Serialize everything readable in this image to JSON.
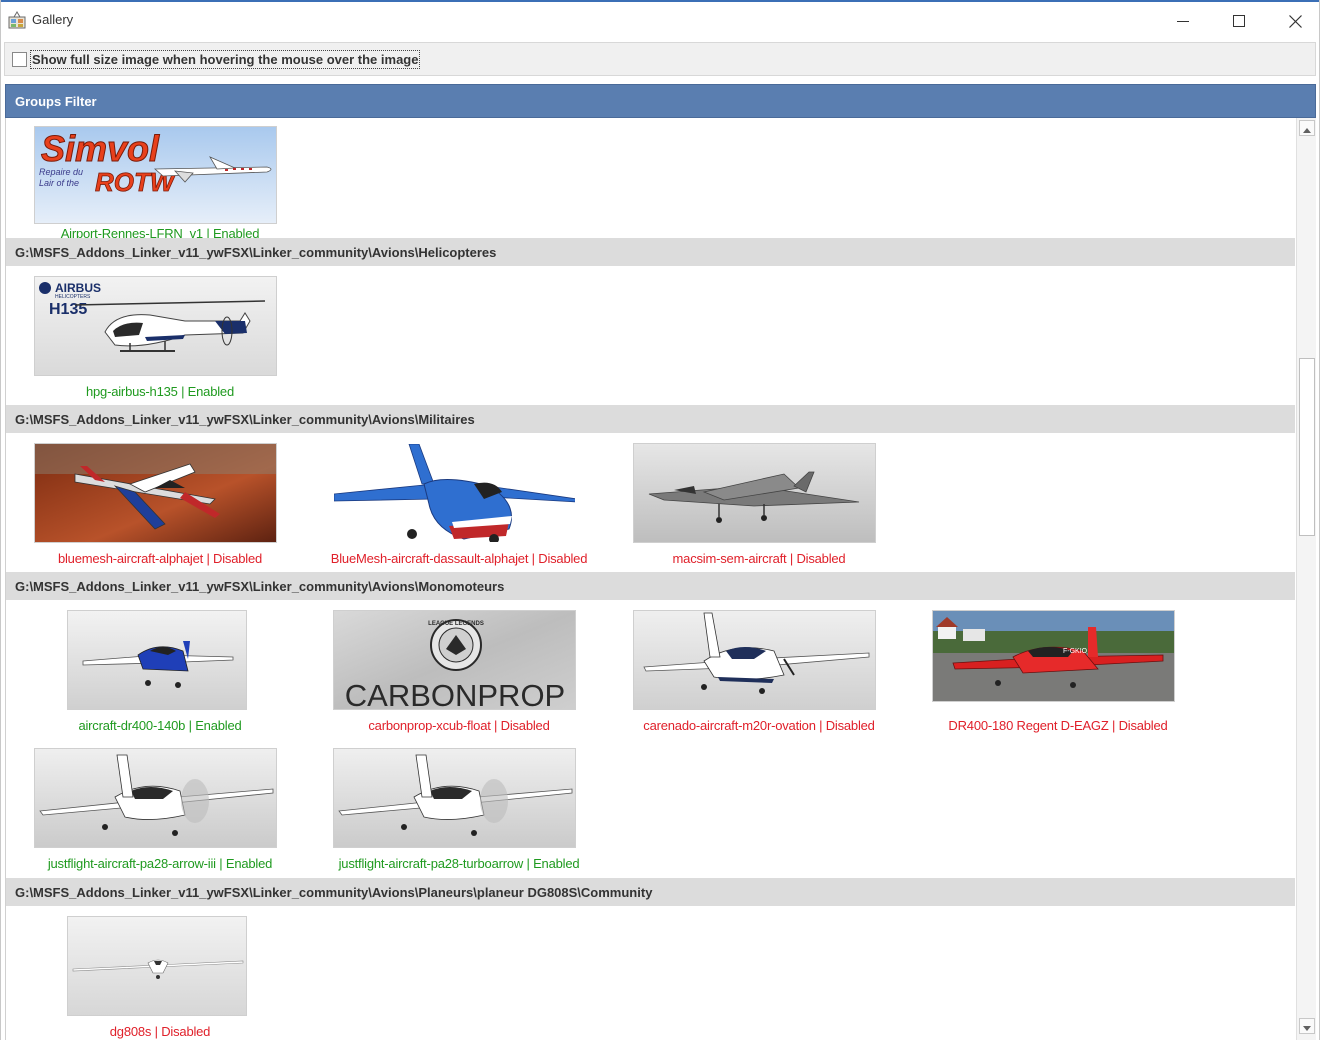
{
  "window": {
    "title": "Gallery",
    "minimize_icon": "minimize-icon",
    "maximize_icon": "maximize-icon",
    "close_icon": "close-icon"
  },
  "options": {
    "hover_checkbox_label": "Show full size image when hovering the mouse over the image",
    "hover_checked": false
  },
  "groups_filter": {
    "title": "Groups Filter"
  },
  "colors": {
    "enabled": "#1f9a1f",
    "disabled": "#e0202a",
    "header_blue": "#5a7eb0",
    "group_gray": "#dcdcdc"
  },
  "groups": [
    {
      "path": "",
      "items": [
        {
          "caption": "Airport-Rennes-LFRN_v1 | Enabled",
          "status": "enabled",
          "thumb": "simvol-rotw-logo"
        }
      ]
    },
    {
      "path": "G:\\MSFS_Addons_Linker_v11_ywFSX\\Linker_community\\Avions\\Helicopteres",
      "items": [
        {
          "caption": "hpg-airbus-h135 | Enabled",
          "status": "enabled",
          "thumb": "airbus-h135-helicopter"
        }
      ]
    },
    {
      "path": "G:\\MSFS_Addons_Linker_v11_ywFSX\\Linker_community\\Avions\\Militaires",
      "items": [
        {
          "caption": "bluemesh-aircraft-alphajet | Disabled",
          "status": "disabled",
          "thumb": "alphajet-red-sky"
        },
        {
          "caption": "BlueMesh-aircraft-dassault-alphajet | Disabled",
          "status": "disabled",
          "thumb": "alphajet-blue"
        },
        {
          "caption": "macsim-sem-aircraft | Disabled",
          "status": "disabled",
          "thumb": "super-etendard-gray"
        }
      ]
    },
    {
      "path": "G:\\MSFS_Addons_Linker_v11_ywFSX\\Linker_community\\Avions\\Monomoteurs",
      "items": [
        {
          "caption": "aircraft-dr400-140b | Enabled",
          "status": "enabled",
          "thumb": "dr400-blue"
        },
        {
          "caption": "carbonprop-xcub-float | Disabled",
          "status": "disabled",
          "thumb": "carbonprop-logo"
        },
        {
          "caption": "carenado-aircraft-m20r-ovation | Disabled",
          "status": "disabled",
          "thumb": "m20r-ovation"
        },
        {
          "caption": "DR400-180 Regent D-EAGZ | Disabled",
          "status": "disabled",
          "thumb": "dr400-red-regent"
        },
        {
          "caption": "justflight-aircraft-pa28-arrow-iii | Enabled",
          "status": "enabled",
          "thumb": "pa28-arrow"
        },
        {
          "caption": "justflight-aircraft-pa28-turboarrow | Enabled",
          "status": "enabled",
          "thumb": "pa28-turboarrow"
        }
      ]
    },
    {
      "path": "G:\\MSFS_Addons_Linker_v11_ywFSX\\Linker_community\\Avions\\Planeurs\\planeur DG808S\\Community",
      "items": [
        {
          "caption": "dg808s | Disabled",
          "status": "disabled",
          "thumb": "dg808s-glider"
        }
      ]
    }
  ],
  "thumb_texts": {
    "simvol_brand": "Simvol",
    "simvol_sub": "ROTW",
    "simvol_tag1": "Repaire du",
    "simvol_tag2": "Lair of the",
    "airbus_brand": "AIRBUS",
    "airbus_sub": "HELICOPTERS",
    "airbus_model": "H135",
    "carbonprop_text": "CARBONPROP",
    "carbonprop_badge": "LEAGUE LEGENDS",
    "dr400_reg": "F-GKIO"
  }
}
